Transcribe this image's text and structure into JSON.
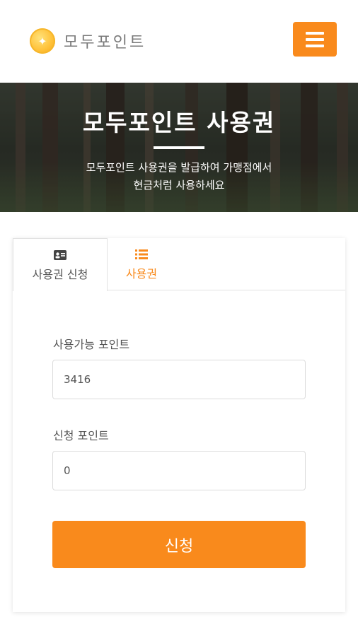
{
  "header": {
    "logo_text": "모두포인트",
    "logo_icon": "coin-icon",
    "menu_icon": "hamburger-menu-icon"
  },
  "hero": {
    "title": "모두포인트 사용권",
    "subtitle_line1": "모두포인트 사용권을 발급하여 가맹점에서",
    "subtitle_line2": "현금처럼 사용하세요"
  },
  "tabs": [
    {
      "label": "사용권 신청",
      "icon": "id-card-icon",
      "active": true
    },
    {
      "label": "사용권",
      "icon": "list-icon",
      "active": false
    }
  ],
  "form": {
    "available_label": "사용가능 포인트",
    "available_value": "3416",
    "request_label": "신청 포인트",
    "request_value": "0",
    "submit_label": "신청"
  },
  "colors": {
    "accent": "#f98a1c",
    "logo_gold": "#ffc23a"
  }
}
